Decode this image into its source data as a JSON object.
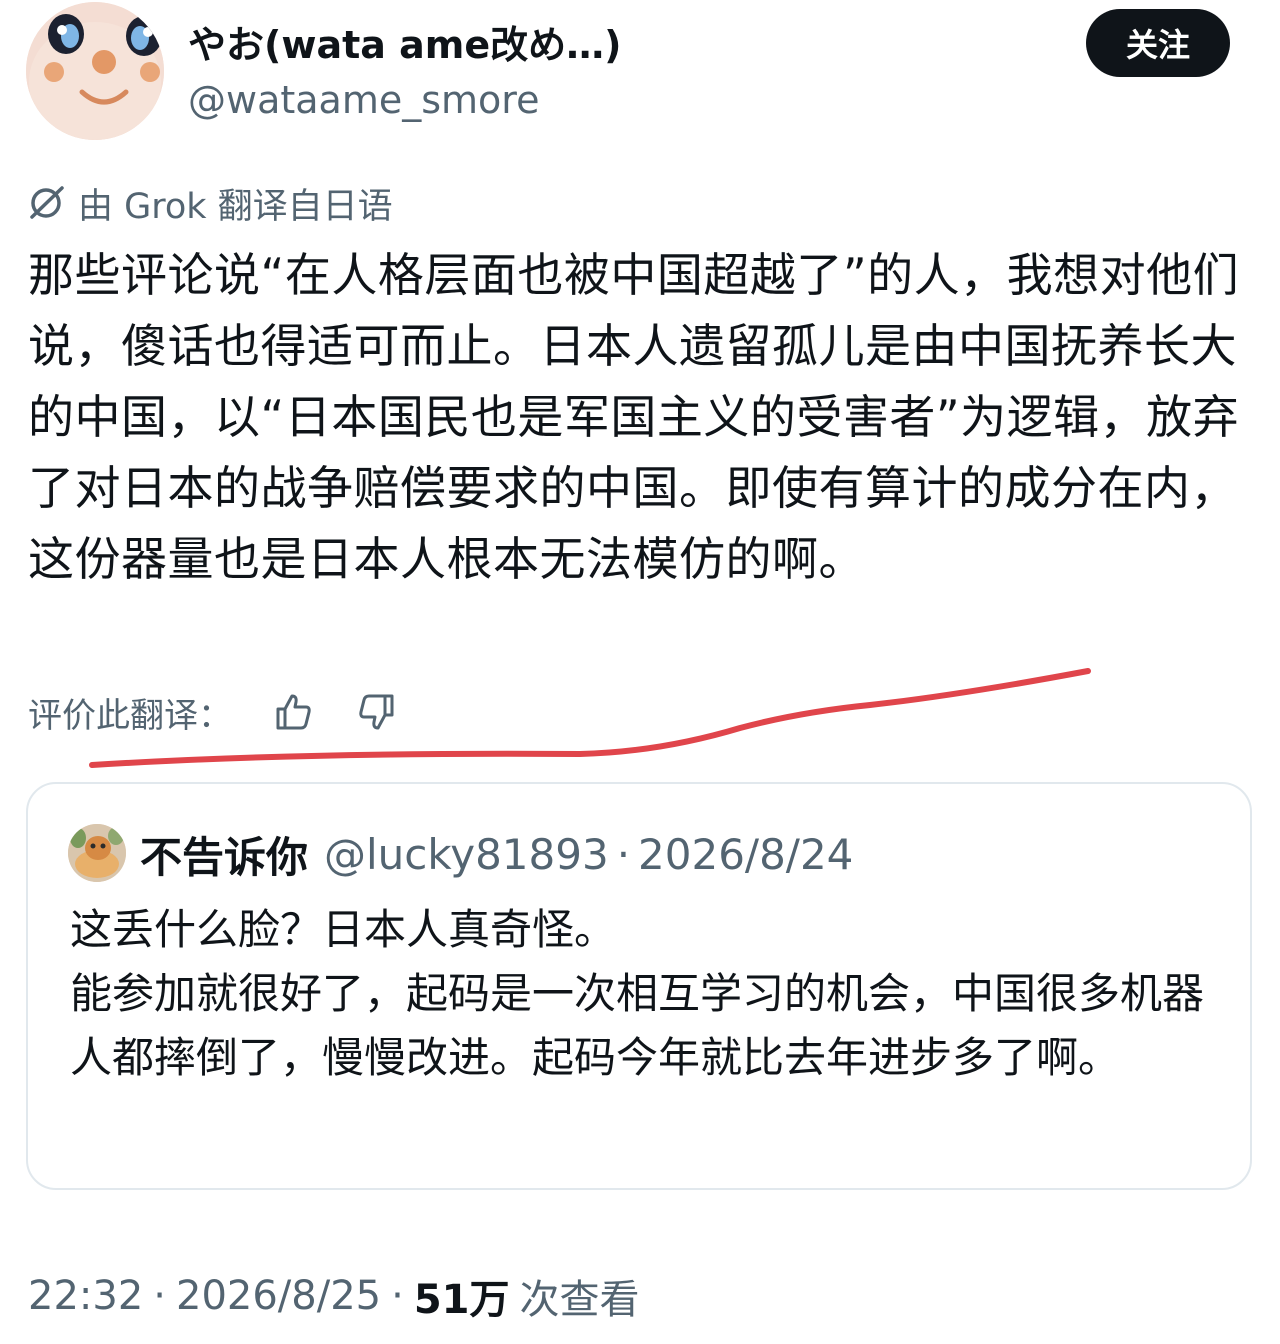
{
  "author": {
    "display_name": "やお(wata ame改め…)",
    "handle": "@wataame_smore"
  },
  "follow_button": {
    "label": "关注"
  },
  "translation": {
    "note": "由 Grok 翻译自日语",
    "rate_label": "评价此翻译："
  },
  "tweet": {
    "text": "那些评论说“在人格层面也被中国超越了”的人，我想对他们说，傻话也得适可而止。日本人遗留孤儿是由中国抚养长大的中国，以“日本国民也是军国主义的受害者”为逻辑，放弃了对日本的战争赔偿要求的中国。即使有算计的成分在内，这份器量也是日本人根本无法模仿的啊。"
  },
  "quoted_tweet": {
    "display_name": "不告诉你",
    "handle": "@lucky81893",
    "separator": "·",
    "date": "2026/8/24",
    "lines": [
      "这丢什么脸？日本人真奇怪。",
      "能参加就很好了，起码是一次相互学习的机会，中国很多机器人都摔倒了，慢慢改进。起码今年就比去年进步多了啊。"
    ]
  },
  "meta": {
    "time": "22:32",
    "separator": "·",
    "date": "2026/8/25",
    "views_count": "51万",
    "views_label": "次查看"
  },
  "icons": {
    "grok": "grok-translate-icon",
    "like": "thumbs-up-icon",
    "dislike": "thumbs-down-icon"
  },
  "colors": {
    "text_primary": "#0f1419",
    "text_secondary": "#536471",
    "button_bg": "#0f1419",
    "annotation_red": "#e0454b",
    "border": "#e1e8ed"
  }
}
